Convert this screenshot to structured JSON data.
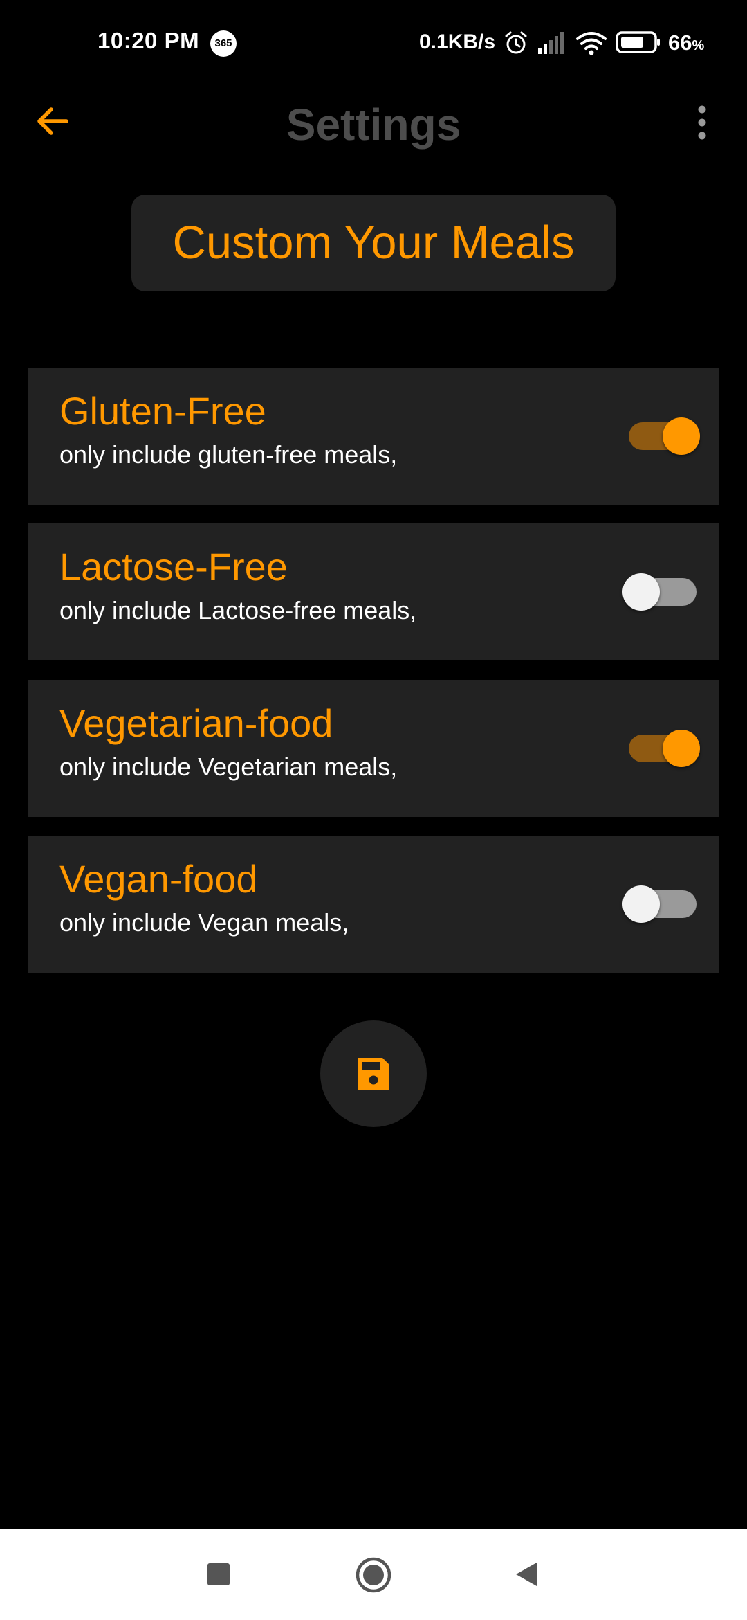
{
  "status_bar": {
    "time": "10:20 PM",
    "app_badge": "365",
    "network_speed": "0.1KB/s",
    "battery_level": "66",
    "battery_unit": "%"
  },
  "app_bar": {
    "title": "Settings",
    "back_icon": "arrow-left-icon",
    "menu_icon": "more-vert-icon"
  },
  "header": {
    "label": "Custom Your Meals"
  },
  "options": [
    {
      "title": "Gluten-Free",
      "description": "only include gluten-free meals,",
      "enabled": true
    },
    {
      "title": "Lactose-Free",
      "description": "only include Lactose-free meals,",
      "enabled": false
    },
    {
      "title": "Vegetarian-food",
      "description": "only include Vegetarian meals,",
      "enabled": true
    },
    {
      "title": "Vegan-food",
      "description": "only include Vegan meals,",
      "enabled": false
    }
  ],
  "save_button": {
    "icon": "save-icon"
  },
  "colors": {
    "accent": "#ff9800",
    "background": "#000000",
    "surface": "#222222",
    "title_gray": "#4d4d4d"
  }
}
